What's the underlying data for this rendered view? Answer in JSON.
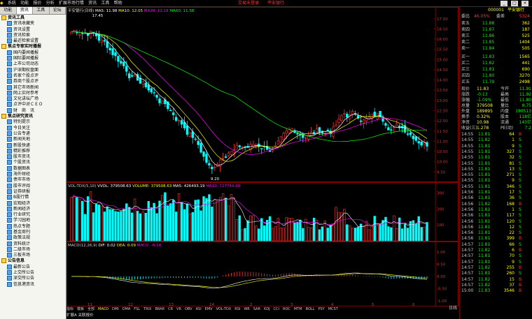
{
  "menubar": {
    "items": [
      "系统",
      "功能",
      "报价",
      "分析",
      "扩展市场行情",
      "资讯",
      "工具",
      "帮助"
    ],
    "center_links": [
      "交易未登录",
      "平安银行"
    ],
    "win_controls": [
      "_",
      "□",
      "×"
    ]
  },
  "sidebar": {
    "tabs": [
      "功能",
      "资讯",
      "工具",
      "论坛"
    ],
    "items": [
      {
        "label": "资讯工具",
        "type": "group"
      },
      {
        "label": "资讯收藏夹",
        "type": "child"
      },
      {
        "label": "资讯设置",
        "type": "child"
      },
      {
        "label": "资讯检索",
        "type": "child"
      },
      {
        "label": "最近检索设置",
        "type": "child"
      },
      {
        "label": "焦点专家实时播报",
        "type": "group"
      },
      {
        "label": "国内要闻播报",
        "type": "child"
      },
      {
        "label": "国际要闻播报",
        "type": "child"
      },
      {
        "label": "上市公司动态",
        "type": "child"
      },
      {
        "label": "沪深期权盘面",
        "type": "child"
      },
      {
        "label": "名家个股点评",
        "type": "child"
      },
      {
        "label": "券商个股点评",
        "type": "child"
      },
      {
        "label": "其它市场新闻",
        "type": "child"
      },
      {
        "label": "网上实时参考",
        "type": "child"
      },
      {
        "label": "文化讲坛广场",
        "type": "child"
      },
      {
        "label": "点评中对ＣＥＯ",
        "type": "child"
      },
      {
        "label": "财　商　讯",
        "type": "child"
      },
      {
        "label": "焦点研究资讯",
        "type": "group"
      },
      {
        "label": "特别提示",
        "type": "child"
      },
      {
        "label": "今日关注",
        "type": "child"
      },
      {
        "label": "公告专递",
        "type": "child"
      },
      {
        "label": "新闻天地",
        "type": "child"
      },
      {
        "label": "新股快递",
        "type": "child"
      },
      {
        "label": "精彩推荐",
        "type": "child"
      },
      {
        "label": "股市资讯",
        "type": "child"
      },
      {
        "label": "个股资讯",
        "type": "child"
      },
      {
        "label": "数据图表",
        "type": "child"
      },
      {
        "label": "海外财经",
        "type": "child"
      },
      {
        "label": "债市市场",
        "type": "child"
      },
      {
        "label": "股市评阅",
        "type": "child"
      },
      {
        "label": "证券研报",
        "type": "child"
      },
      {
        "label": "B股行情",
        "type": "child"
      },
      {
        "label": "宏观经济",
        "type": "child"
      },
      {
        "label": "新闻经济",
        "type": "child"
      },
      {
        "label": "行业研究",
        "type": "child"
      },
      {
        "label": "学习园地",
        "type": "child"
      },
      {
        "label": "热点专题",
        "type": "child"
      },
      {
        "label": "基金周刊",
        "type": "child"
      },
      {
        "label": "政策法规",
        "type": "child"
      },
      {
        "label": "资料统计",
        "type": "child"
      },
      {
        "label": "二级市场",
        "type": "child"
      },
      {
        "label": "三板市场",
        "type": "child"
      },
      {
        "label": "公告信息",
        "type": "group"
      },
      {
        "label": "最新公告",
        "type": "child"
      },
      {
        "label": "上交所公告",
        "type": "child"
      },
      {
        "label": "深交所公告",
        "type": "child"
      },
      {
        "label": "信息港资讯",
        "type": "child"
      }
    ]
  },
  "chart_header": {
    "title": "平安银行(日线)",
    "ma": [
      {
        "label": "MA5: 11.98",
        "color": "#ffffff"
      },
      {
        "label": "MA10: 12.05",
        "color": "#ffff00"
      },
      {
        "label": "MA20: 12.18",
        "color": "#ff00ff"
      },
      {
        "label": "MA60: 11.58",
        "color": "#00ff00"
      }
    ],
    "high_label": "17.45",
    "low_label": "9.20"
  },
  "volume_header": {
    "items": [
      {
        "label": "VOL-TDX(5,10)",
        "color": "#cccccc"
      },
      {
        "label": "VVOL: 379508.63",
        "color": "#ffffff"
      },
      {
        "label": "VOLUME: 379508.63",
        "color": "#ffff00"
      },
      {
        "label": "MA5: 426493.19",
        "color": "#ffffff"
      },
      {
        "label": "MA10: 727744.00",
        "color": "#ff00ff"
      }
    ]
  },
  "macd_header": {
    "items": [
      {
        "label": "MACD(12,26,9)",
        "color": "#cccccc"
      },
      {
        "label": "DIF: 0.02",
        "color": "#ffffff"
      },
      {
        "label": "DEA: 0.09",
        "color": "#ffff00"
      },
      {
        "label": "MACD: -0.14",
        "color": "#ff00ff"
      }
    ]
  },
  "price_axis": [
    "17.00",
    "16.50",
    "16.00",
    "15.50",
    "15.00",
    "14.50",
    "14.00",
    "13.50",
    "13.00",
    "12.50",
    "12.00",
    "11.50",
    "11.00",
    "10.50",
    "10.00",
    "9.50"
  ],
  "volume_axis": [
    "300",
    "200",
    "100"
  ],
  "macd_axis": [
    "1.00",
    "0.50",
    "0.00",
    "-0.50",
    "-1.00"
  ],
  "x_axis": [
    "11",
    "12",
    "13",
    "14",
    "2",
    "3",
    "4",
    "5",
    "6"
  ],
  "indicator_tabs": [
    "指标",
    "模板",
    "全部",
    "MACD",
    "DMI",
    "DMA",
    "FSL",
    "TRIX",
    "BRAR",
    "CR",
    "VR",
    "OBV",
    "ASI",
    "EMV",
    "VOL-TDX",
    "RSI",
    "WR",
    "SAR",
    "KDJ",
    "CCI",
    "ROC",
    "MTM",
    "BOLL",
    "PSY",
    "MCST"
  ],
  "status_bar": "扩展A  关联报价",
  "panel": {
    "code": "000001",
    "name": "平安银行",
    "weibi": {
      "label": "委比",
      "value": "46.05%",
      "vol_label": "委差",
      "vol": "5324"
    },
    "asks": [
      {
        "label": "卖五",
        "price": "11.88",
        "vol": "362"
      },
      {
        "label": "卖四",
        "price": "11.87",
        "vol": "187"
      },
      {
        "label": "卖三",
        "price": "11.86",
        "vol": "525"
      },
      {
        "label": "卖二",
        "price": "11.85",
        "vol": "1404"
      },
      {
        "label": "卖一",
        "price": "11.84",
        "vol": "505"
      }
    ],
    "bids": [
      {
        "label": "买一",
        "price": "11.83",
        "vol": "1565"
      },
      {
        "label": "买二",
        "price": "11.82",
        "vol": "441"
      },
      {
        "label": "买三",
        "price": "11.81",
        "vol": "690"
      },
      {
        "label": "买四",
        "price": "11.80",
        "vol": "3270"
      },
      {
        "label": "买五",
        "price": "11.79",
        "vol": "2498"
      }
    ],
    "quote": [
      {
        "l1": "现价",
        "v1": "11.83",
        "l2": "今开",
        "v2": "11.91"
      },
      {
        "l1": "涨跌",
        "v1": "-0.13",
        "l2": "最高",
        "v2": "11.92"
      },
      {
        "l1": "涨幅",
        "v1": "-1.09%",
        "l2": "最低",
        "v2": "11.80"
      },
      {
        "l1": "总量",
        "v1": "379508",
        "l2": "量比",
        "v2": "0.75"
      },
      {
        "l1": "外盘",
        "v1": "189895",
        "l2": "内盘",
        "v2": "190513"
      },
      {
        "l1": "换手",
        "v1": "0.32%",
        "l2": "股本",
        "v2": "118亿"
      },
      {
        "l1": "净资",
        "v1": "10.98",
        "l2": "流通",
        "v2": "143亿"
      },
      {
        "l1": "收益(三)",
        "v1": "1.278",
        "l2": "PE(动)",
        "v2": "7.2"
      }
    ],
    "ticks": [
      {
        "time": "14:55",
        "price": "11.81",
        "vol": "64",
        "side": "B"
      },
      {
        "time": "14:55",
        "price": "11.82",
        "vol": "1",
        "side": "S"
      },
      {
        "time": "14:55",
        "price": "11.81",
        "vol": "9",
        "side": "S"
      },
      {
        "time": "14:55",
        "price": "11.81",
        "vol": "327",
        "side": "S"
      },
      {
        "time": "14:55",
        "price": "11.81",
        "vol": "32",
        "side": "S"
      },
      {
        "time": "14:55",
        "price": "11.81",
        "vol": "81",
        "side": "S"
      },
      {
        "time": "14:55",
        "price": "11.81",
        "vol": "13",
        "side": "S"
      },
      {
        "time": "14:55",
        "price": "11.81",
        "vol": "271",
        "side": "S"
      },
      {
        "time": "14:55",
        "price": "11.81",
        "vol": "9",
        "side": "S"
      },
      {
        "time": "14:55",
        "price": "11.81",
        "vol": "346",
        "side": "S"
      },
      {
        "time": "14:56",
        "price": "11.81",
        "vol": "17",
        "side": "S"
      },
      {
        "time": "14:56",
        "price": "11.81",
        "vol": "36",
        "side": "S"
      },
      {
        "time": "14:56",
        "price": "11.82",
        "vol": "168",
        "side": "B"
      },
      {
        "time": "14:56",
        "price": "11.81",
        "vol": "1",
        "side": "S"
      },
      {
        "time": "14:56",
        "price": "11.81",
        "vol": "117",
        "side": "S"
      },
      {
        "time": "14:56",
        "price": "11.81",
        "vol": "120",
        "side": "S"
      },
      {
        "time": "14:56",
        "price": "11.81",
        "vol": "12",
        "side": "S"
      },
      {
        "time": "14:56",
        "price": "11.81",
        "vol": "22",
        "side": "S"
      },
      {
        "time": "14:56",
        "price": "11.81",
        "vol": "399",
        "side": "B"
      },
      {
        "time": "14:57",
        "price": "11.81",
        "vol": "66",
        "side": "S"
      },
      {
        "time": "14:57",
        "price": "11.82",
        "vol": "6",
        "side": "B"
      },
      {
        "time": "14:57",
        "price": "11.81",
        "vol": "70",
        "side": "S"
      },
      {
        "time": "14:57",
        "price": "11.81",
        "vol": "9",
        "side": "S"
      },
      {
        "time": "14:57",
        "price": "11.82",
        "vol": "255",
        "side": "B"
      },
      {
        "time": "14:57",
        "price": "11.81",
        "vol": "260",
        "side": "S"
      },
      {
        "time": "14:57",
        "price": "11.82",
        "vol": "15",
        "side": "B"
      },
      {
        "time": "14:57",
        "price": "11.82",
        "vol": "37",
        "side": "B"
      },
      {
        "time": "15:00",
        "price": "11.83",
        "vol": "3546",
        "side": "B"
      }
    ],
    "ticks_label": "日线"
  },
  "colors": {
    "up": "#ff3333",
    "down": "#00ffff",
    "price_up": "#ff3333",
    "price_down": "#00ff00",
    "frame": "#880000"
  }
}
